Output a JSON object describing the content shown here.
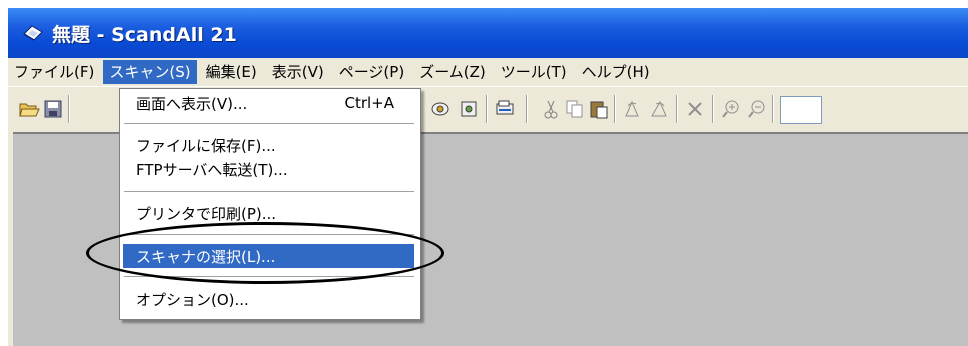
{
  "window": {
    "title": "無題 - ScandAll 21",
    "title_icon": "scanner-app-icon"
  },
  "menubar": {
    "items": [
      {
        "label": "ファイル(F)"
      },
      {
        "label": "スキャン(S)"
      },
      {
        "label": "編集(E)"
      },
      {
        "label": "表示(V)"
      },
      {
        "label": "ページ(P)"
      },
      {
        "label": "ズーム(Z)"
      },
      {
        "label": "ツール(T)"
      },
      {
        "label": "ヘルプ(H)"
      }
    ]
  },
  "toolbar": {
    "icons": [
      "open-folder-icon",
      "save-icon",
      "scan-icon",
      "scan-batch-icon",
      "scan-settings-icon",
      "cut-icon",
      "copy-icon",
      "paste-icon",
      "rotate-left-icon",
      "rotate-right-icon",
      "delete-icon",
      "zoom-in-icon",
      "zoom-out-icon"
    ]
  },
  "scan_menu": {
    "items": [
      {
        "label": "画面へ表示(V)...",
        "shortcut": "Ctrl+A"
      },
      {
        "label": "ファイルに保存(F)...",
        "shortcut": ""
      },
      {
        "label": "FTPサーバへ転送(T)...",
        "shortcut": ""
      },
      {
        "label": "プリンタで印刷(P)...",
        "shortcut": ""
      },
      {
        "label": "スキャナの選択(L)...",
        "shortcut": ""
      },
      {
        "label": "オプション(O)...",
        "shortcut": ""
      }
    ],
    "selected_label": "スキャナの選択(L)..."
  },
  "colors": {
    "titlebar": "#0a4bd6",
    "selection": "#316ac5",
    "workspace": "#c0c0c0",
    "chrome": "#ece9d8"
  }
}
